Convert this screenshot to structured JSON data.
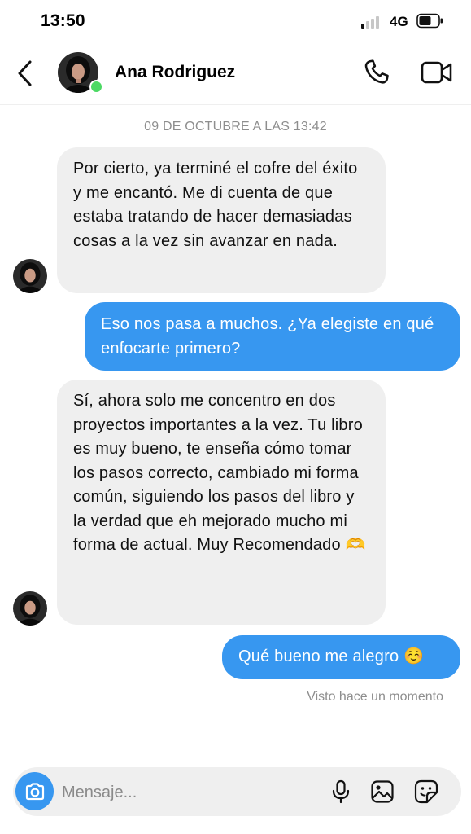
{
  "status_bar": {
    "time": "13:50",
    "network": "4G"
  },
  "header": {
    "contact_name": "Ana Rodriguez"
  },
  "thread": {
    "timestamp": "09 DE OCTUBRE A LAS 13:42",
    "messages": [
      {
        "direction": "incoming",
        "text": "Por cierto, ya terminé el cofre del éxito y me encantó. Me di cuenta de que estaba tratando de hacer demasiadas cosas a la vez sin avanzar en nada."
      },
      {
        "direction": "outgoing",
        "text": "Eso nos pasa a muchos. ¿Ya elegiste en qué enfocarte primero?"
      },
      {
        "direction": "incoming",
        "text": "Sí, ahora solo me concentro en dos proyectos importantes a la vez. Tu libro es muy bueno, te enseña cómo tomar los pasos correcto, cambiado mi forma común, siguiendo los pasos del libro y la verdad que eh mejorado mucho mi forma de actual. Muy Recomendado 🫶"
      },
      {
        "direction": "outgoing",
        "text": "Qué bueno me alegro ☺️"
      }
    ],
    "seen_status": "Visto hace un momento"
  },
  "composer": {
    "placeholder": "Mensaje..."
  },
  "colors": {
    "accent_blue": "#3797f0",
    "incoming_bubble": "#efefef",
    "online_green": "#4cd964",
    "muted_text": "#8e8e8e"
  },
  "icons": [
    "back-chevron-icon",
    "phone-icon",
    "video-camera-icon",
    "camera-icon",
    "microphone-icon",
    "image-icon",
    "sticker-icon"
  ]
}
